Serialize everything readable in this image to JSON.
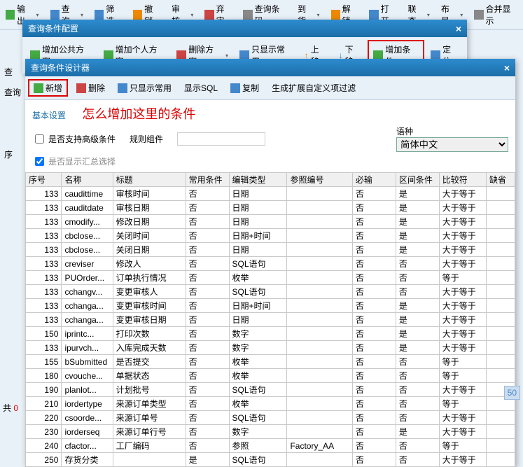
{
  "main_toolbar": {
    "items": [
      "输出",
      "查询",
      "筛选",
      "撤销",
      "审核",
      "弃审",
      "查询条码",
      "到货",
      "解锁",
      "打开",
      "联查",
      "布局",
      "合并显示"
    ]
  },
  "dlg1": {
    "title": "查询条件配置",
    "buttons": [
      "增加公共方案",
      "增加个人方案",
      "删除方案",
      "只显示常用",
      "上移",
      "下移",
      "增加条件",
      "定位"
    ]
  },
  "dlg2": {
    "title": "查询条件设计器",
    "toolbar": [
      "新增",
      "删除",
      "只显示常用",
      "显示SQL",
      "复制",
      "生成扩展自定义项过滤"
    ],
    "fs_label": "基本设置",
    "annotation": "怎么增加这里的条件",
    "chk_adv": "是否支持高级条件",
    "lbl_rule": "规则组件",
    "chk_sum": "是否显示汇总选择",
    "lbl_lang": "语种",
    "lang_value": "简体中文",
    "columns": [
      "序号",
      "名称",
      "标题",
      "常用条件",
      "编辑类型",
      "参照编号",
      "必输",
      "区间条件",
      "比较符",
      "缺省"
    ],
    "rows": [
      {
        "seq": "133",
        "name": "caudittime",
        "title": "审核时间",
        "common": "否",
        "edit": "日期",
        "ref": "",
        "must": "否",
        "range": "是",
        "cmp": "大于等于"
      },
      {
        "seq": "133",
        "name": "cauditdate",
        "title": "审核日期",
        "common": "否",
        "edit": "日期",
        "ref": "",
        "must": "否",
        "range": "是",
        "cmp": "大于等于"
      },
      {
        "seq": "133",
        "name": "cmodify...",
        "title": "修改日期",
        "common": "否",
        "edit": "日期",
        "ref": "",
        "must": "否",
        "range": "是",
        "cmp": "大于等于"
      },
      {
        "seq": "133",
        "name": "cbclose...",
        "title": "关闭时间",
        "common": "否",
        "edit": "日期+时间",
        "ref": "",
        "must": "否",
        "range": "是",
        "cmp": "大于等于"
      },
      {
        "seq": "133",
        "name": "cbclose...",
        "title": "关闭日期",
        "common": "否",
        "edit": "日期",
        "ref": "",
        "must": "否",
        "range": "是",
        "cmp": "大于等于"
      },
      {
        "seq": "133",
        "name": "creviser",
        "title": "修改人",
        "common": "否",
        "edit": "SQL语句",
        "ref": "",
        "must": "否",
        "range": "否",
        "cmp": "大于等于"
      },
      {
        "seq": "133",
        "name": "PUOrder...",
        "title": "订单执行情况",
        "common": "否",
        "edit": "枚举",
        "ref": "",
        "must": "否",
        "range": "否",
        "cmp": "等于"
      },
      {
        "seq": "133",
        "name": "cchangv...",
        "title": "变更审核人",
        "common": "否",
        "edit": "SQL语句",
        "ref": "",
        "must": "否",
        "range": "否",
        "cmp": "大于等于"
      },
      {
        "seq": "133",
        "name": "cchanga...",
        "title": "变更审核时间",
        "common": "否",
        "edit": "日期+时间",
        "ref": "",
        "must": "否",
        "range": "是",
        "cmp": "大于等于"
      },
      {
        "seq": "133",
        "name": "cchanga...",
        "title": "变更审核日期",
        "common": "否",
        "edit": "日期",
        "ref": "",
        "must": "否",
        "range": "是",
        "cmp": "大于等于"
      },
      {
        "seq": "150",
        "name": "iprintc...",
        "title": "打印次数",
        "common": "否",
        "edit": "数字",
        "ref": "",
        "must": "否",
        "range": "是",
        "cmp": "大于等于"
      },
      {
        "seq": "133",
        "name": "ipurvch...",
        "title": "入库完成天数",
        "common": "否",
        "edit": "数字",
        "ref": "",
        "must": "否",
        "range": "是",
        "cmp": "大于等于"
      },
      {
        "seq": "155",
        "name": "bSubmitted",
        "title": "是否提交",
        "common": "否",
        "edit": "枚举",
        "ref": "",
        "must": "否",
        "range": "否",
        "cmp": "等于"
      },
      {
        "seq": "180",
        "name": "cvouche...",
        "title": "单据状态",
        "common": "否",
        "edit": "枚举",
        "ref": "",
        "must": "否",
        "range": "否",
        "cmp": "等于"
      },
      {
        "seq": "190",
        "name": "planlot...",
        "title": "计划批号",
        "common": "否",
        "edit": "SQL语句",
        "ref": "",
        "must": "否",
        "range": "否",
        "cmp": "大于等于"
      },
      {
        "seq": "210",
        "name": "iordertype",
        "title": "来源订单类型",
        "common": "否",
        "edit": "枚举",
        "ref": "",
        "must": "否",
        "range": "否",
        "cmp": "等于"
      },
      {
        "seq": "220",
        "name": "csoorde...",
        "title": "来源订单号",
        "common": "否",
        "edit": "SQL语句",
        "ref": "",
        "must": "否",
        "range": "否",
        "cmp": "大于等于"
      },
      {
        "seq": "230",
        "name": "iorderseq",
        "title": "来源订单行号",
        "common": "否",
        "edit": "数字",
        "ref": "",
        "must": "否",
        "range": "是",
        "cmp": "大于等于"
      },
      {
        "seq": "240",
        "name": "cfactor...",
        "title": "工厂编码",
        "common": "否",
        "edit": "参照",
        "ref": "Factory_AA",
        "must": "否",
        "range": "否",
        "cmp": "等于"
      },
      {
        "seq": "250",
        "name": "存货分类",
        "title": "",
        "common": "是",
        "edit": "SQL语句",
        "ref": "",
        "must": "否",
        "range": "否",
        "cmp": "大于等于"
      }
    ]
  },
  "left": {
    "a": "查",
    "b": "查询",
    "c": "序"
  },
  "footer": {
    "prefix": "共 ",
    "count": "0"
  },
  "page_badge": "50"
}
